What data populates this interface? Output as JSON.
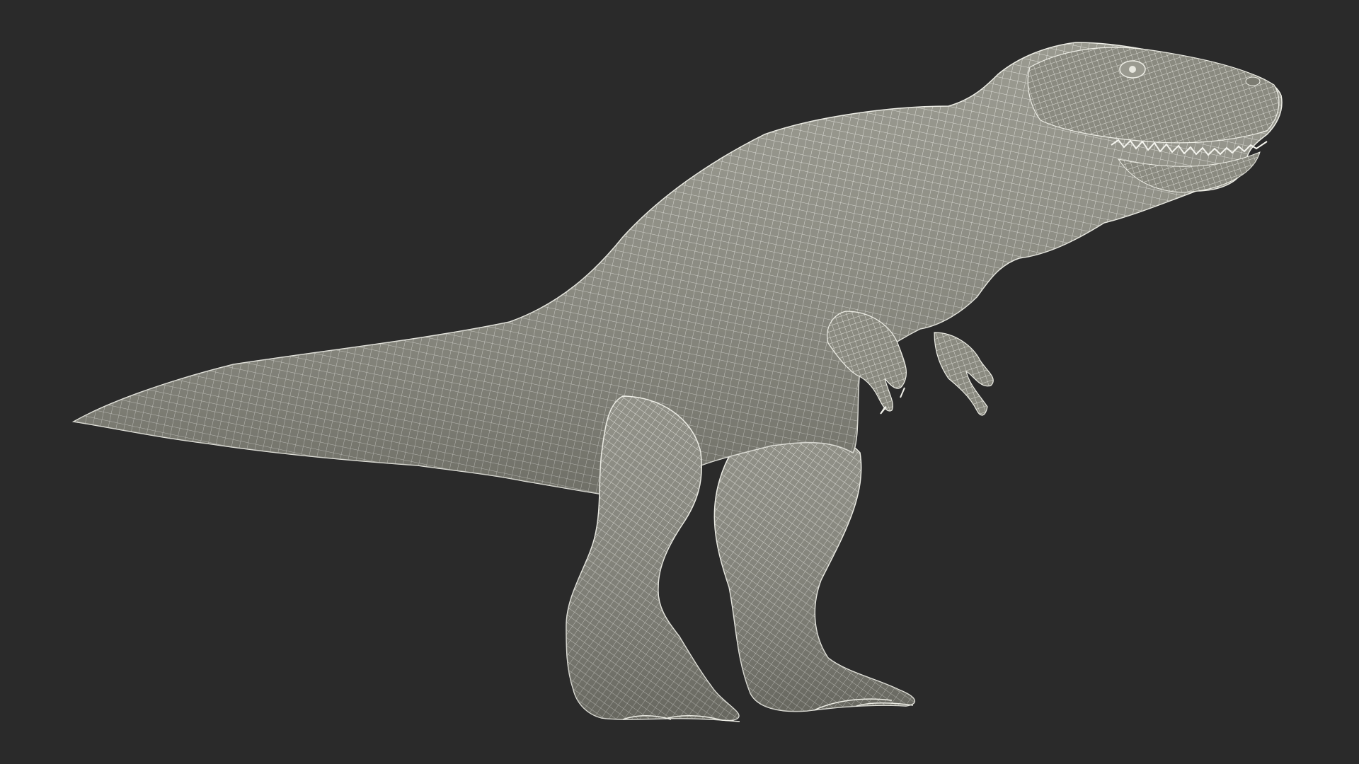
{
  "scene": {
    "background_color": "#2a2a2a",
    "mesh_fill_color": "#8e8e83",
    "mesh_wire_color": "#eeeee6",
    "subject_icon": "t-rex-wireframe-model"
  }
}
